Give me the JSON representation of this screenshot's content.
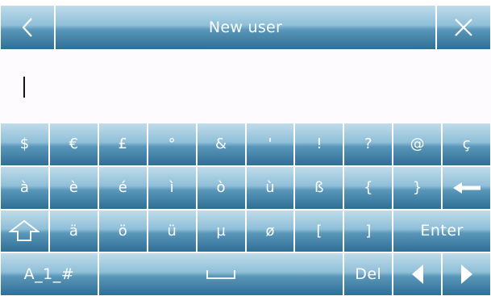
{
  "header": {
    "title": "New user",
    "back_icon": "chevron-left-icon",
    "close_icon": "close-icon"
  },
  "input": {
    "value": ""
  },
  "keyboard": {
    "row1": [
      "$",
      "€",
      "£",
      "°",
      "&",
      "'",
      "!",
      "?",
      "@",
      "ç"
    ],
    "row2": [
      "à",
      "è",
      "é",
      "ì",
      "ò",
      "ù",
      "ß",
      "{",
      "}"
    ],
    "row2_backspace_icon": "backspace-arrow-icon",
    "row3_shift_icon": "shift-up-icon",
    "row3": [
      "ä",
      "ö",
      "ü",
      "µ",
      "ø",
      "[",
      "]"
    ],
    "enter_label": "Enter",
    "mode_label": "A_1_#",
    "space_icon": "space-bar-icon",
    "del_label": "Del",
    "left_icon": "arrow-left-icon",
    "right_icon": "arrow-right-icon"
  },
  "colors": {
    "key_top": "#bfdcea",
    "key_bottom": "#2f6f95",
    "text": "#ffffff",
    "input_bg": "#fdfbfd"
  }
}
